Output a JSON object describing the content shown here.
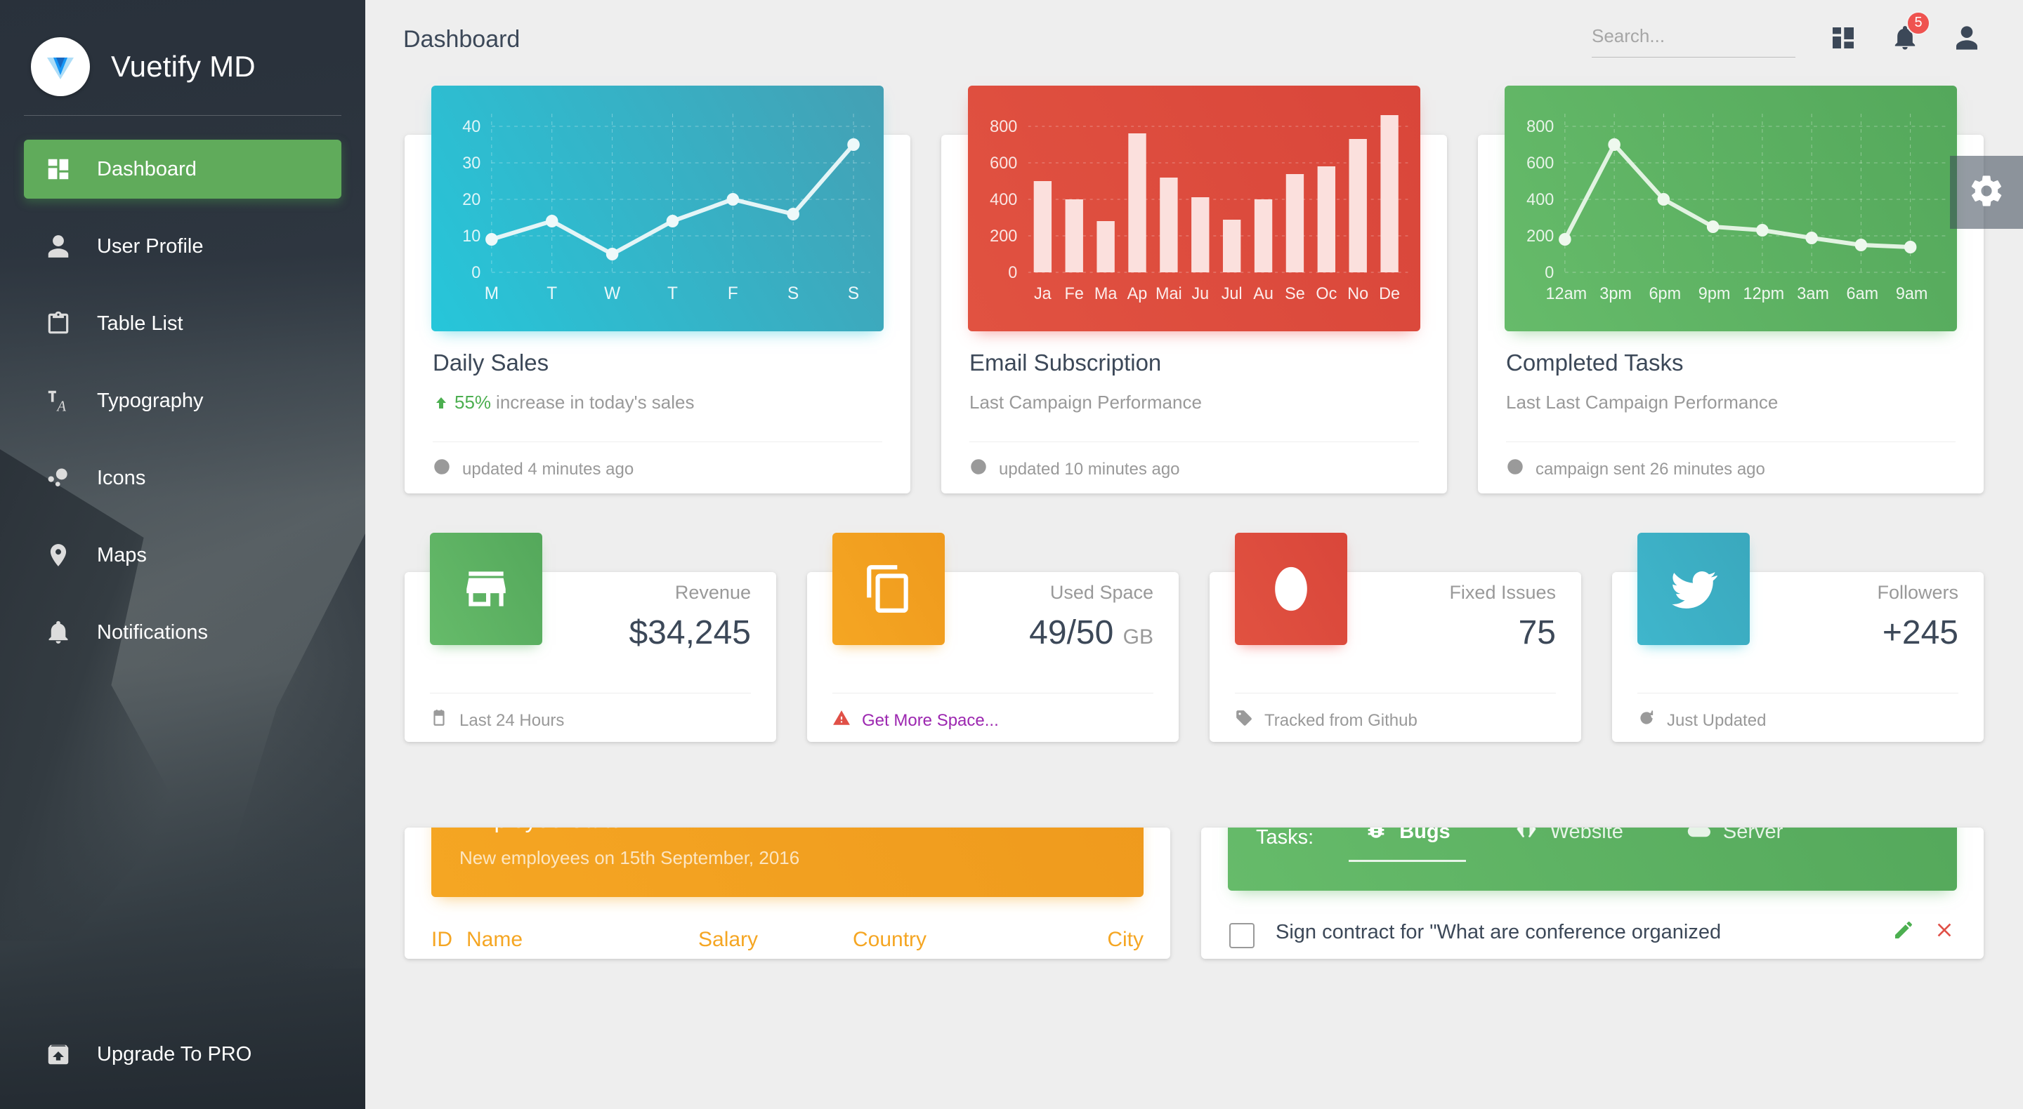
{
  "brand": {
    "title": "Vuetify MD",
    "logo_icon": "vuetify-logo-icon"
  },
  "sidebar": {
    "items": [
      {
        "label": "Dashboard",
        "icon": "dashboard-icon",
        "active": true
      },
      {
        "label": "User Profile",
        "icon": "person-icon",
        "active": false
      },
      {
        "label": "Table List",
        "icon": "clipboard-icon",
        "active": false
      },
      {
        "label": "Typography",
        "icon": "typography-icon",
        "active": false
      },
      {
        "label": "Icons",
        "icon": "bubble-icon",
        "active": false
      },
      {
        "label": "Maps",
        "icon": "map-pin-icon",
        "active": false
      },
      {
        "label": "Notifications",
        "icon": "bell-icon",
        "active": false
      }
    ],
    "upgrade": {
      "label": "Upgrade To PRO",
      "icon": "unarchive-icon"
    }
  },
  "header": {
    "title": "Dashboard",
    "search_placeholder": "Search...",
    "search_value": "",
    "apps_icon": "dashboard-grid-icon",
    "notifications_icon": "bell-icon",
    "notifications_badge": "5",
    "account_icon": "person-icon"
  },
  "settings_fab": {
    "icon": "gear-icon",
    "label": "Settings"
  },
  "chart_cards": [
    {
      "title": "Daily Sales",
      "subtitle_prefix": "55%",
      "subtitle": "increase in today's sales",
      "trend_icon": "arrow-up-icon",
      "footer": "updated 4 minutes ago",
      "footer_icon": "clock-icon",
      "accent": "#26c6da"
    },
    {
      "title": "Email Subscription",
      "subtitle_prefix": "",
      "subtitle": "Last Campaign Performance",
      "trend_icon": "",
      "footer": "updated 10 minutes ago",
      "footer_icon": "clock-icon",
      "accent": "#e15241"
    },
    {
      "title": "Completed Tasks",
      "subtitle_prefix": "",
      "subtitle": "Last Last Campaign Performance",
      "trend_icon": "",
      "footer": "campaign sent 26 minutes ago",
      "footer_icon": "clock-icon",
      "accent": "#66bb6a"
    }
  ],
  "stat_cards": [
    {
      "label": "Revenue",
      "value": "$34,245",
      "unit": "",
      "icon": "store-icon",
      "color": "#66bb6a",
      "footer": "Last 24 Hours",
      "footer_icon": "calendar-icon",
      "footer_link": false
    },
    {
      "label": "Used Space",
      "value": "49/50",
      "unit": "GB",
      "icon": "copy-icon",
      "color": "#f5a623",
      "footer": "Get More Space...",
      "footer_icon": "warning-icon",
      "footer_link": true
    },
    {
      "label": "Fixed Issues",
      "value": "75",
      "unit": "",
      "icon": "info-icon",
      "color": "#e15241",
      "footer": "Tracked from Github",
      "footer_icon": "tag-icon",
      "footer_link": false
    },
    {
      "label": "Followers",
      "value": "+245",
      "unit": "",
      "icon": "twitter-icon",
      "color": "#3fb6cc",
      "footer": "Just Updated",
      "footer_icon": "refresh-icon",
      "footer_link": false
    }
  ],
  "employee_stats": {
    "title": "Employee Stats",
    "subtitle": "New employees on 15th September, 2016",
    "columns": [
      "ID",
      "Name",
      "Salary",
      "Country",
      "City"
    ]
  },
  "tasks": {
    "label": "Tasks:",
    "tabs": [
      {
        "label": "Bugs",
        "icon": "bug-icon",
        "active": true
      },
      {
        "label": "Website",
        "icon": "code-icon",
        "active": false
      },
      {
        "label": "Server",
        "icon": "cloud-icon",
        "active": false
      }
    ],
    "items": [
      {
        "text": "Sign contract for \"What are conference organized",
        "checked": false,
        "edit_icon": "edit-icon",
        "delete_icon": "close-icon"
      }
    ]
  },
  "chart_data": [
    {
      "type": "line",
      "title": "Daily Sales",
      "categories": [
        "M",
        "T",
        "W",
        "T",
        "F",
        "S",
        "S"
      ],
      "values": [
        9,
        14,
        5,
        14,
        20,
        16,
        35
      ],
      "ylabel": "",
      "xlabel": "",
      "yticks": [
        0,
        10,
        20,
        30,
        40
      ],
      "ylim": [
        0,
        45
      ],
      "grid": true,
      "legend": "none",
      "series_color": "#ffffff",
      "background": "#26c6da"
    },
    {
      "type": "bar",
      "title": "Email Subscription",
      "categories": [
        "Ja",
        "Fe",
        "Ma",
        "Ap",
        "Mai",
        "Ju",
        "Jul",
        "Au",
        "Se",
        "Oc",
        "No",
        "De"
      ],
      "values": [
        500,
        400,
        280,
        760,
        520,
        410,
        290,
        400,
        540,
        580,
        730,
        860
      ],
      "ylabel": "",
      "xlabel": "",
      "yticks": [
        0,
        200,
        400,
        600,
        800
      ],
      "ylim": [
        0,
        900
      ],
      "grid": true,
      "legend": "none",
      "series_color": "#fbe0dd",
      "background": "#e15241"
    },
    {
      "type": "line",
      "title": "Completed Tasks",
      "categories": [
        "12am",
        "3pm",
        "6pm",
        "9pm",
        "12pm",
        "3am",
        "6am",
        "9am"
      ],
      "values": [
        180,
        700,
        400,
        250,
        230,
        190,
        150,
        140
      ],
      "ylabel": "",
      "xlabel": "",
      "yticks": [
        0,
        200,
        400,
        600,
        800
      ],
      "ylim": [
        0,
        900
      ],
      "grid": true,
      "legend": "none",
      "series_color": "#ffffff",
      "background": "#66bb6a"
    }
  ]
}
